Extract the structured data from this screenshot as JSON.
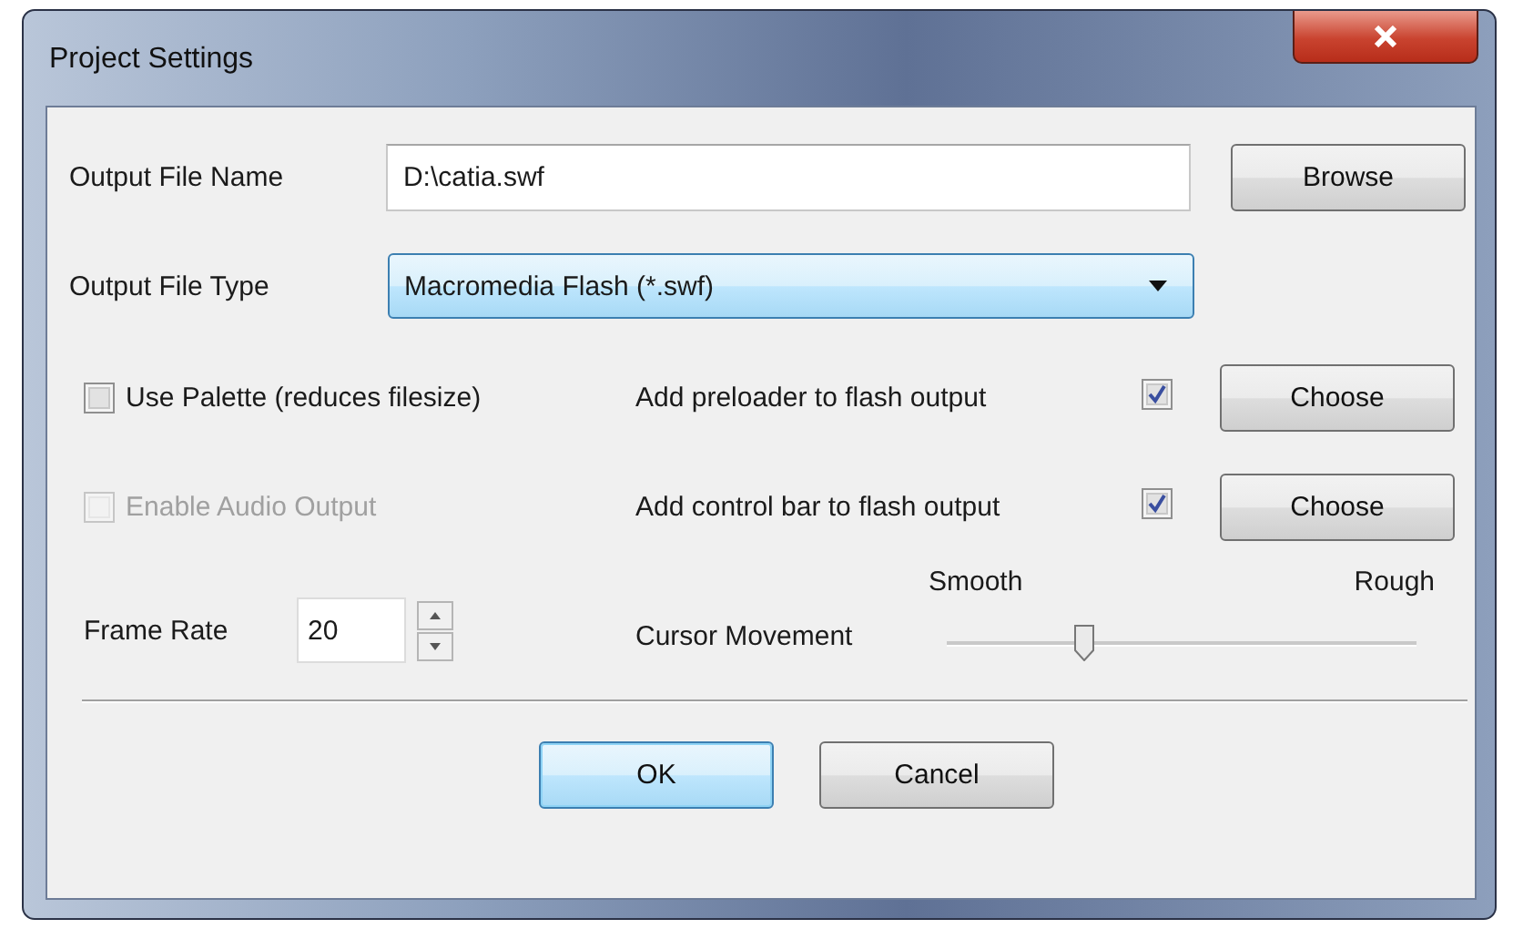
{
  "window": {
    "title": "Project Settings"
  },
  "output_file_name": {
    "label": "Output File Name",
    "value": "D:\\catia.swf",
    "button": "Browse"
  },
  "output_file_type": {
    "label": "Output File Type",
    "value": "Macromedia Flash (*.swf)"
  },
  "options": [
    {
      "label": "Use Palette (reduces filesize)",
      "checked": false,
      "disabled": false
    },
    {
      "label": "Enable Audio Output",
      "checked": false,
      "disabled": true
    }
  ],
  "flash_options": [
    {
      "label": "Add preloader to flash output",
      "checked": true,
      "button": "Choose"
    },
    {
      "label": "Add control bar to flash output",
      "checked": true,
      "button": "Choose"
    }
  ],
  "frame_rate": {
    "label": "Frame Rate",
    "value": "20"
  },
  "cursor_movement": {
    "label": "Cursor Movement",
    "min_label": "Smooth",
    "max_label": "Rough",
    "level": 0.29
  },
  "buttons": [
    {
      "label": "OK",
      "default": true
    },
    {
      "label": "Cancel",
      "default": false
    }
  ]
}
